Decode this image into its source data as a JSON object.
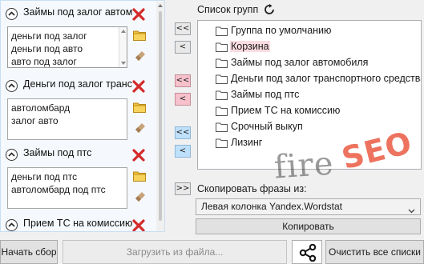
{
  "groups_panel": {
    "groups": [
      {
        "title": "Займы под залог автомобиля",
        "phrases": [
          "деньги под залог",
          "деньги под авто",
          "авто под залог"
        ]
      },
      {
        "title": "Деньги под залог транспортного средства",
        "phrases": [
          "автоломбард",
          "залог авто"
        ]
      },
      {
        "title": "Займы под птс",
        "phrases": [
          "деньги под птс",
          "автоломбард под птс"
        ]
      },
      {
        "title": "Прием ТС на комиссию",
        "phrases": []
      }
    ]
  },
  "move_buttons": {
    "pink_all": "<<",
    "pink_one": "<",
    "gray_all": "<<",
    "gray_one": "<",
    "blue_all": "<<",
    "blue_one": "<"
  },
  "group_list": {
    "label": "Список групп",
    "items": [
      "Группа по умолчанию",
      "Корзина",
      "Займы под залог автомобиля",
      "Деньги под залог транспортного средства",
      "Займы под птс",
      "Прием ТС на комиссию",
      "Срочный выкуп",
      "Лизинг"
    ],
    "selected_index": 1
  },
  "copy": {
    "arrow": ">>",
    "label": "Скопировать фразы из:",
    "source_value": "Левая колонка Yandex.Wordstat",
    "button_label": "Копировать"
  },
  "bottom": {
    "start_label": "Начать сбор",
    "load_label": "Загрузить из файла...",
    "clear_label": "Очистить все списки"
  },
  "watermark": {
    "text_dark": "fire",
    "text_accent": "SEO"
  },
  "colors": {
    "pink_button": "#f7c1cc",
    "blue_button": "#bfe0fb",
    "selected_item": "#fbdce2",
    "delete_red": "#d42a2a",
    "folder_yellow": "#f2c33a"
  }
}
